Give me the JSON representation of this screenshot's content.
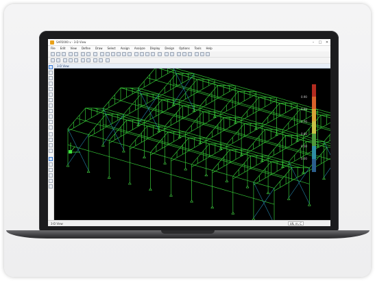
{
  "window": {
    "title": "SAP2000 v - 3-D View",
    "controls": [
      "–",
      "□",
      "✕"
    ]
  },
  "menu": [
    "File",
    "Edit",
    "View",
    "Define",
    "Draw",
    "Select",
    "Assign",
    "Analyze",
    "Display",
    "Design",
    "Options",
    "Tools",
    "Help"
  ],
  "view": {
    "tab_label": "3-D View",
    "background": "#000000",
    "frame_color": "#39d43a"
  },
  "legend": {
    "labels": [
      "0.90",
      "0.80",
      "0.70",
      "0.60",
      "0.50",
      "0.00"
    ],
    "colors": [
      "#b22b1f",
      "#d7612a",
      "#d9a437",
      "#c8c246",
      "#4f9a3c",
      "#2f8fa3",
      "#2b5e8c"
    ]
  },
  "status": {
    "left_text": "3-D View",
    "units": "kN, m, C"
  }
}
